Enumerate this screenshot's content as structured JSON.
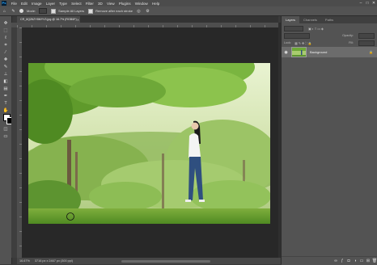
{
  "menu": {
    "logo": "Ps",
    "items": [
      "File",
      "Edit",
      "Image",
      "Layer",
      "Type",
      "Select",
      "Filter",
      "3D",
      "View",
      "Plugins",
      "Window",
      "Help"
    ],
    "controls": [
      "–",
      "□",
      "✕"
    ]
  },
  "options": {
    "mode_label": "Mode:",
    "sample_label": "Sample All Layers",
    "remove_label": "Remove after each stroke"
  },
  "document": {
    "tab_title": "CR_6QZ6ZY8MYV3.jpg @ 16.7% (RGB/8*)",
    "zoom": "16.67%",
    "dims": "3716 px x 2467 px (300 ppi)"
  },
  "panel": {
    "tabs": [
      "Layers",
      "Channels",
      "Paths"
    ],
    "kind_label": "Kind",
    "mode_label": "Normal",
    "opacity_label": "Opacity:",
    "lock_label": "Lock:",
    "fill_label": "Fill:",
    "layer_name": "Background"
  },
  "icons": {
    "tools": [
      "move-icon",
      "marquee-icon",
      "lasso-icon",
      "magic-wand-icon",
      "crop-icon",
      "eyedropper-icon",
      "healing-brush-icon",
      "brush-icon",
      "clone-stamp-icon",
      "history-brush-icon",
      "eraser-icon",
      "gradient-icon",
      "blur-icon",
      "dodge-icon",
      "pen-icon",
      "type-icon",
      "path-select-icon",
      "shape-icon",
      "hand-icon",
      "zoom-icon"
    ],
    "panel_bottom": [
      "link-icon",
      "fx-icon",
      "mask-icon",
      "adjustment-icon",
      "group-icon",
      "new-layer-icon",
      "trash-icon"
    ]
  },
  "colors": {
    "foreground": "#ffffff",
    "background": "#000000"
  }
}
